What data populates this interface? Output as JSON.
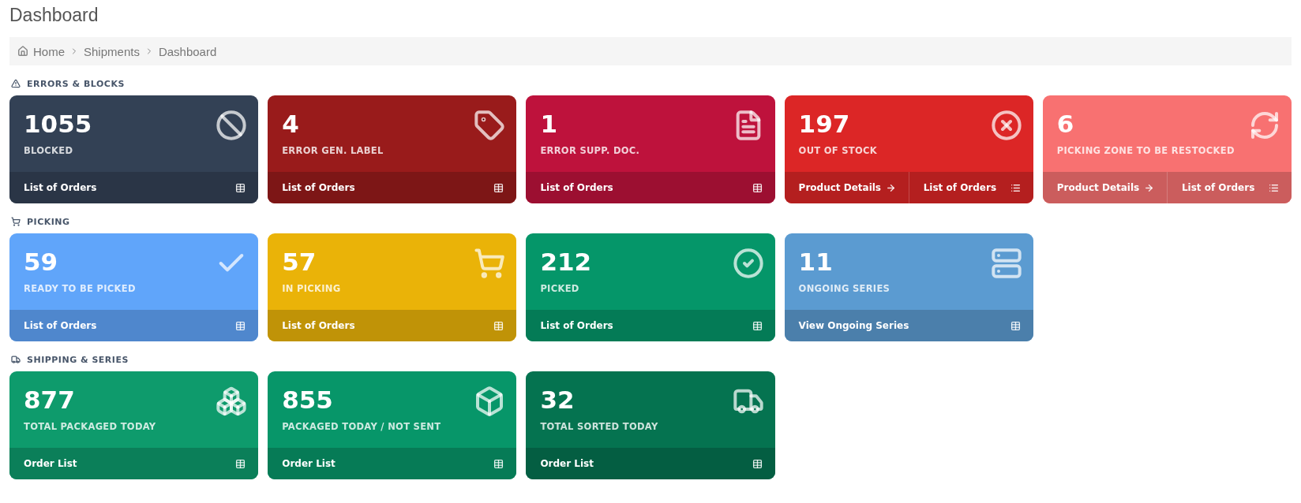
{
  "page_title": "Dashboard",
  "breadcrumb": [
    {
      "label": "Home",
      "kind": "home"
    },
    {
      "label": "Shipments",
      "kind": "plain"
    },
    {
      "label": "Dashboard",
      "kind": "plain"
    }
  ],
  "sections": [
    {
      "title": "ERRORS & BLOCKS",
      "kind": "warning",
      "cards": [
        {
          "value": "1055",
          "label": "BLOCKED",
          "kind": "ban",
          "color": "#334155",
          "links": [
            {
              "label": "List of Orders",
              "kind": "table"
            }
          ]
        },
        {
          "value": "4",
          "label": "ERROR GEN. LABEL",
          "kind": "tag",
          "color": "#991b1b",
          "links": [
            {
              "label": "List of Orders",
              "kind": "table"
            }
          ]
        },
        {
          "value": "1",
          "label": "ERROR SUPP. DOC.",
          "kind": "file",
          "color": "#be123c",
          "links": [
            {
              "label": "List of Orders",
              "kind": "table"
            }
          ]
        },
        {
          "value": "197",
          "label": "OUT OF STOCK",
          "kind": "xcircle",
          "color": "#dc2626",
          "links": [
            {
              "label": "Product Details",
              "kind": "arrow"
            },
            {
              "label": "List of Orders",
              "kind": "list"
            }
          ]
        },
        {
          "value": "6",
          "label": "PICKING ZONE TO BE RESTOCKED",
          "kind": "refresh",
          "color": "#f87171",
          "links": [
            {
              "label": "Product Details",
              "kind": "arrow"
            },
            {
              "label": "List of Orders",
              "kind": "list"
            }
          ]
        }
      ]
    },
    {
      "title": "PICKING",
      "kind": "cart",
      "cards": [
        {
          "value": "59",
          "label": "READY TO BE PICKED",
          "kind": "check",
          "color": "#60a5fa",
          "links": [
            {
              "label": "List of Orders",
              "kind": "table"
            }
          ]
        },
        {
          "value": "57",
          "label": "IN PICKING",
          "kind": "cart",
          "color": "#eab308",
          "links": [
            {
              "label": "List of Orders",
              "kind": "table"
            }
          ]
        },
        {
          "value": "212",
          "label": "PICKED",
          "kind": "checkcircle",
          "color": "#059669",
          "links": [
            {
              "label": "List of Orders",
              "kind": "table"
            }
          ]
        },
        {
          "value": "11",
          "label": "ONGOING SERIES",
          "kind": "server",
          "color": "#5b9bd1",
          "links": [
            {
              "label": "View Ongoing Series",
              "kind": "table"
            }
          ]
        }
      ]
    },
    {
      "title": "SHIPPING & SERIES",
      "kind": "truck",
      "cards": [
        {
          "value": "877",
          "label": "TOTAL PACKAGED TODAY",
          "kind": "boxes",
          "color": "#0e9b6c",
          "links": [
            {
              "label": "Order List",
              "kind": "table"
            }
          ]
        },
        {
          "value": "855",
          "label": "PACKAGED TODAY / NOT SENT",
          "kind": "box",
          "color": "#079669",
          "links": [
            {
              "label": "Order List",
              "kind": "table"
            }
          ]
        },
        {
          "value": "32",
          "label": "TOTAL SORTED TODAY",
          "kind": "truck",
          "color": "#057350",
          "links": [
            {
              "label": "Order List",
              "kind": "table"
            }
          ]
        }
      ]
    }
  ]
}
